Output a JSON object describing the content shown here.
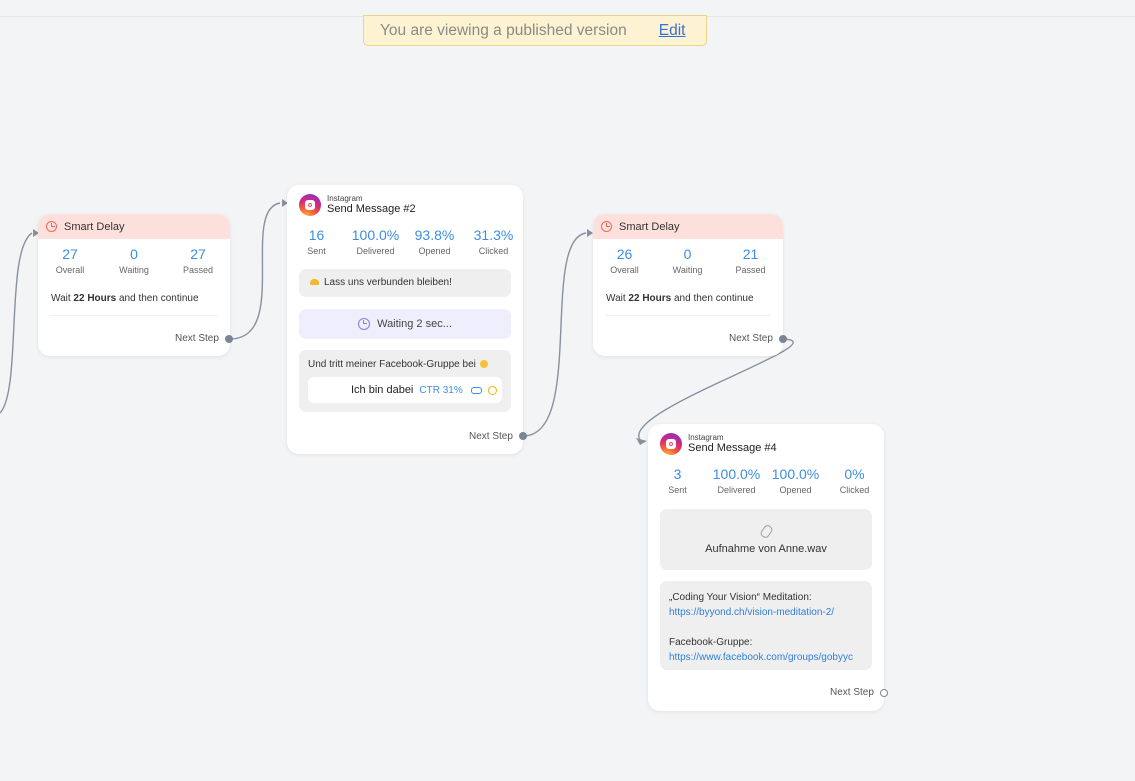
{
  "banner": {
    "message": "You are viewing a published version",
    "edit_label": "Edit"
  },
  "delay1": {
    "title": "Smart Delay",
    "stats": [
      {
        "value": "27",
        "label": "Overall"
      },
      {
        "value": "0",
        "label": "Waiting"
      },
      {
        "value": "27",
        "label": "Passed"
      }
    ],
    "wait_prefix": "Wait",
    "wait_amount": "22 Hours",
    "wait_suffix": "and then continue",
    "next_step": "Next Step"
  },
  "msg2": {
    "platform": "Instagram",
    "title": "Send Message #2",
    "stats": [
      {
        "value": "16",
        "label": "Sent"
      },
      {
        "value": "100.0%",
        "label": "Delivered"
      },
      {
        "value": "93.8%",
        "label": "Opened"
      },
      {
        "value": "31.3%",
        "label": "Clicked"
      }
    ],
    "text1": "Lass uns verbunden bleiben!",
    "waiting": "Waiting 2 sec...",
    "text2": "Und tritt meiner Facebook-Gruppe bei",
    "button_label": "Ich bin dabei",
    "ctr": "CTR 31%",
    "next_step": "Next Step"
  },
  "delay2": {
    "title": "Smart Delay",
    "stats": [
      {
        "value": "26",
        "label": "Overall"
      },
      {
        "value": "0",
        "label": "Waiting"
      },
      {
        "value": "21",
        "label": "Passed"
      }
    ],
    "wait_prefix": "Wait",
    "wait_amount": "22 Hours",
    "wait_suffix": "and then continue",
    "next_step": "Next Step"
  },
  "msg4": {
    "platform": "Instagram",
    "title": "Send Message #4",
    "stats": [
      {
        "value": "3",
        "label": "Sent"
      },
      {
        "value": "100.0%",
        "label": "Delivered"
      },
      {
        "value": "100.0%",
        "label": "Opened"
      },
      {
        "value": "0%",
        "label": "Clicked"
      }
    ],
    "attachment": "Aufnahme von Anne.wav",
    "line1": "„Coding Your Vision“ Meditation:",
    "link1": "https://byyond.ch/vision-meditation-2/",
    "line2": "Facebook-Gruppe:",
    "link2": "https://www.facebook.com/groups/gobyyc",
    "next_step": "Next Step"
  },
  "icons": [
    "clock-icon",
    "instagram-icon",
    "paperclip-icon",
    "link-icon"
  ]
}
